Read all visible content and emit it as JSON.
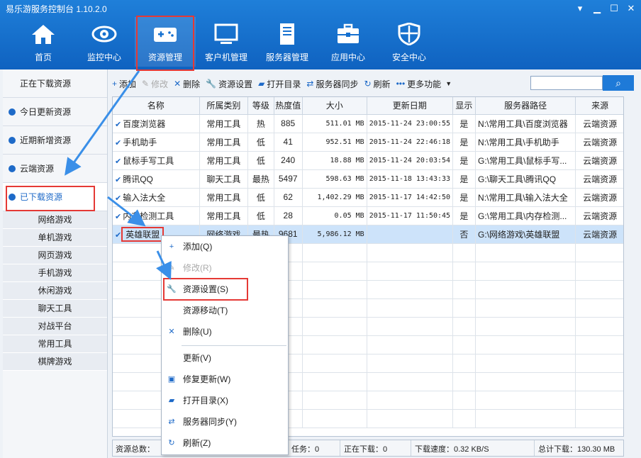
{
  "app": {
    "title": "易乐游服务控制台 1.10.2.0"
  },
  "nav": [
    {
      "label": "首页",
      "icon": "home-icon"
    },
    {
      "label": "监控中心",
      "icon": "eye-icon"
    },
    {
      "label": "资源管理",
      "icon": "gamepad-icon",
      "active": true
    },
    {
      "label": "客户机管理",
      "icon": "monitor-icon"
    },
    {
      "label": "服务器管理",
      "icon": "server-icon"
    },
    {
      "label": "应用中心",
      "icon": "toolbox-icon"
    },
    {
      "label": "安全中心",
      "icon": "shield-icon"
    }
  ],
  "sidebar": {
    "items": [
      {
        "label": "正在下载资源",
        "dot": false
      },
      {
        "label": "今日更新资源",
        "dot": true
      },
      {
        "label": "近期新增资源",
        "dot": true
      },
      {
        "label": "云端资源",
        "dot": true
      },
      {
        "label": "已下载资源",
        "dot": true,
        "selected": true
      }
    ],
    "subitems": [
      "网络游戏",
      "单机游戏",
      "网页游戏",
      "手机游戏",
      "休闲游戏",
      "聊天工具",
      "对战平台",
      "常用工具",
      "棋牌游戏"
    ]
  },
  "toolbar": {
    "add": "添加",
    "edit": "修改",
    "delete": "删除",
    "settings": "资源设置",
    "open_dir": "打开目录",
    "sync": "服务器同步",
    "refresh": "刷新",
    "more": "更多功能"
  },
  "table": {
    "headers": [
      "名称",
      "所属类别",
      "等级",
      "热度值",
      "大小",
      "更新日期",
      "显示",
      "服务器路径",
      "来源"
    ],
    "rows": [
      [
        "百度浏览器",
        "常用工具",
        "热",
        "885",
        "511.01 MB",
        "2015-11-24 23:00:55",
        "是",
        "N:\\常用工具\\百度浏览器",
        "云端资源"
      ],
      [
        "手机助手",
        "常用工具",
        "低",
        "41",
        "952.51 MB",
        "2015-11-24 22:46:18",
        "是",
        "N:\\常用工具\\手机助手",
        "云端资源"
      ],
      [
        "鼠标手写工具",
        "常用工具",
        "低",
        "240",
        "18.88 MB",
        "2015-11-24 20:03:54",
        "是",
        "G:\\常用工具\\鼠标手写...",
        "云端资源"
      ],
      [
        "腾讯QQ",
        "聊天工具",
        "最热",
        "5497",
        "598.63 MB",
        "2015-11-18 13:43:33",
        "是",
        "G:\\聊天工具\\腾讯QQ",
        "云端资源"
      ],
      [
        "输入法大全",
        "常用工具",
        "低",
        "62",
        "1,402.29 MB",
        "2015-11-17 14:42:50",
        "是",
        "N:\\常用工具\\输入法大全",
        "云端资源"
      ],
      [
        "内存检测工具",
        "常用工具",
        "低",
        "28",
        "0.05 MB",
        "2015-11-17 11:50:45",
        "是",
        "G:\\常用工具\\内存检测...",
        "云端资源"
      ],
      [
        "英雄联盟",
        "网络游戏",
        "最热",
        "9681",
        "5,986.12 MB",
        "",
        "否",
        "G:\\网络游戏\\英雄联盟",
        "云端资源"
      ]
    ]
  },
  "status": {
    "total": "资源总数：",
    "tasks": "任务：0",
    "downloading": "正在下载：0",
    "speed": "下载速度：0.32 KB/S",
    "total_download": "总计下载：130.30 MB"
  },
  "context_menu": {
    "items": [
      {
        "label": "添加(Q)",
        "icon": "plus-icon"
      },
      {
        "label": "修改(R)",
        "icon": "pencil-icon",
        "disabled": true
      },
      {
        "label": "资源设置(S)",
        "icon": "wrench-icon",
        "highlight": true
      },
      {
        "label": "资源移动(T)",
        "icon": ""
      },
      {
        "label": "删除(U)",
        "icon": "x-icon"
      },
      {
        "label": "更新(V)",
        "icon": ""
      },
      {
        "label": "修复更新(W)",
        "icon": "repair-icon"
      },
      {
        "label": "打开目录(X)",
        "icon": "folder-icon"
      },
      {
        "label": "服务器同步(Y)",
        "icon": "sync-icon"
      },
      {
        "label": "刷新(Z)",
        "icon": "refresh-icon"
      }
    ]
  },
  "colors": {
    "header": "#1570d0",
    "accent": "#1e6ac8",
    "annotation": "#e53935",
    "arrow": "#3a8fe8",
    "selected_row": "#cde3fa"
  }
}
